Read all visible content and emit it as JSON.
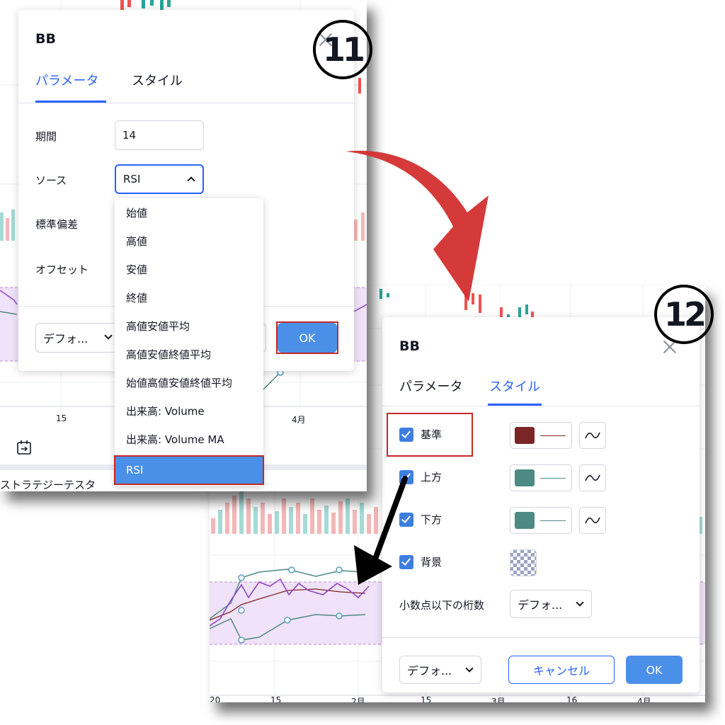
{
  "steps": {
    "left": "11",
    "right": "12"
  },
  "left_panel": {
    "title": "BB",
    "tabs": [
      "パラメータ",
      "スタイル"
    ],
    "active_tab": "パラメータ",
    "fields": {
      "period_label": "期間",
      "period_value": "14",
      "source_label": "ソース",
      "source_value": "RSI",
      "stddev_label": "標準偏差",
      "offset_label": "オフセット"
    },
    "source_options": [
      "始値",
      "高値",
      "安値",
      "終値",
      "高値安値平均",
      "高値安値終値平均",
      "始値高値安値終値平均",
      "出来高: Volume",
      "出来高: Volume MA",
      "RSI"
    ],
    "selected_option": "RSI",
    "defaults_label": "デフォ...",
    "ok_label": "OK",
    "axis_labels": [
      "15",
      "4月"
    ],
    "bottom_text": "ストラテジーテスタ"
  },
  "right_panel": {
    "title": "BB",
    "tabs": [
      "パラメータ",
      "スタイル"
    ],
    "active_tab": "スタイル",
    "style_rows": [
      {
        "label": "基準",
        "checked": true,
        "color": "#7b2626"
      },
      {
        "label": "上方",
        "checked": true,
        "color": "#4e8a84"
      },
      {
        "label": "下方",
        "checked": true,
        "color": "#4e8a84"
      },
      {
        "label": "背景",
        "checked": true
      }
    ],
    "precision_label": "小数点以下の桁数",
    "precision_value": "デフォ...",
    "defaults_label": "デフォ...",
    "cancel_label": "キャンセル",
    "ok_label": "OK",
    "axis_labels": [
      "20",
      "15",
      "2月",
      "15",
      "3月",
      "16",
      "4月"
    ]
  },
  "colors": {
    "accent": "#2962ff",
    "highlight": "#c62828",
    "arrow_red": "#d32f2f",
    "band_fill": "#f0e2f8"
  }
}
